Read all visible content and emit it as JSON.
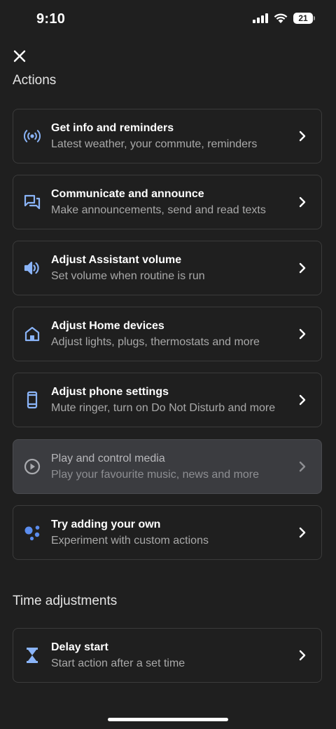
{
  "status": {
    "time": "9:10",
    "battery": "21"
  },
  "header": {
    "close_icon": "close-icon"
  },
  "sections": {
    "actions": {
      "heading": "Actions",
      "items": [
        {
          "title": "Get info and reminders",
          "subtitle": "Latest weather, your commute, reminders",
          "icon": "broadcast-icon"
        },
        {
          "title": "Communicate and announce",
          "subtitle": "Make announcements, send and read texts",
          "icon": "chat-icon"
        },
        {
          "title": "Adjust Assistant volume",
          "subtitle": "Set volume when routine is run",
          "icon": "volume-icon"
        },
        {
          "title": "Adjust Home devices",
          "subtitle": "Adjust lights, plugs, thermostats and more",
          "icon": "home-icon"
        },
        {
          "title": "Adjust phone settings",
          "subtitle": "Mute ringer, turn on Do Not Disturb and more",
          "icon": "phone-icon"
        },
        {
          "title": "Play and control media",
          "subtitle": "Play your favourite music, news and more",
          "icon": "play-circle-icon"
        },
        {
          "title": "Try adding your own",
          "subtitle": "Experiment with custom actions",
          "icon": "assistant-dots-icon"
        }
      ]
    },
    "time_adjustments": {
      "heading": "Time adjustments",
      "items": [
        {
          "title": "Delay start",
          "subtitle": "Start action after a set time",
          "icon": "hourglass-icon"
        }
      ]
    }
  },
  "colors": {
    "background": "#1f1f1f",
    "accent": "#8ab4f8",
    "card_border": "#3b3b3b",
    "highlight": "#3b3c40"
  }
}
